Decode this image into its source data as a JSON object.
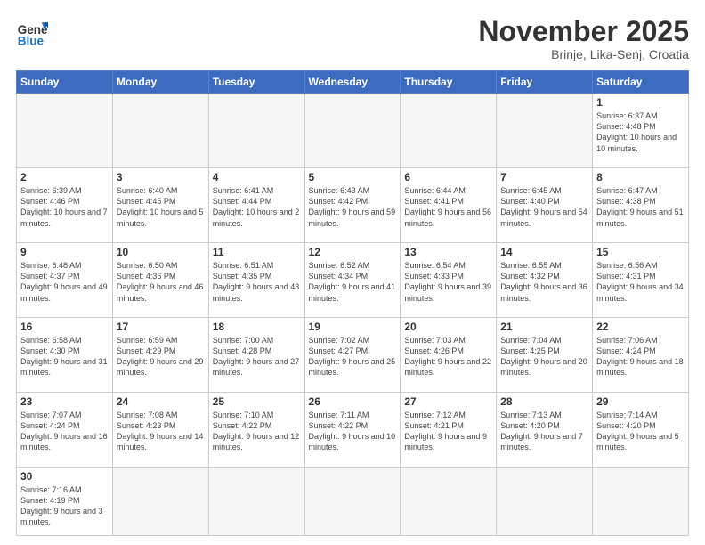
{
  "header": {
    "logo_general": "General",
    "logo_blue": "Blue",
    "title": "November 2025",
    "subtitle": "Brinje, Lika-Senj, Croatia"
  },
  "weekdays": [
    "Sunday",
    "Monday",
    "Tuesday",
    "Wednesday",
    "Thursday",
    "Friday",
    "Saturday"
  ],
  "days": {
    "d1": {
      "num": "1",
      "sunrise": "6:37 AM",
      "sunset": "4:48 PM",
      "daylight": "10 hours and 10 minutes."
    },
    "d2": {
      "num": "2",
      "sunrise": "6:39 AM",
      "sunset": "4:46 PM",
      "daylight": "10 hours and 7 minutes."
    },
    "d3": {
      "num": "3",
      "sunrise": "6:40 AM",
      "sunset": "4:45 PM",
      "daylight": "10 hours and 5 minutes."
    },
    "d4": {
      "num": "4",
      "sunrise": "6:41 AM",
      "sunset": "4:44 PM",
      "daylight": "10 hours and 2 minutes."
    },
    "d5": {
      "num": "5",
      "sunrise": "6:43 AM",
      "sunset": "4:42 PM",
      "daylight": "9 hours and 59 minutes."
    },
    "d6": {
      "num": "6",
      "sunrise": "6:44 AM",
      "sunset": "4:41 PM",
      "daylight": "9 hours and 56 minutes."
    },
    "d7": {
      "num": "7",
      "sunrise": "6:45 AM",
      "sunset": "4:40 PM",
      "daylight": "9 hours and 54 minutes."
    },
    "d8": {
      "num": "8",
      "sunrise": "6:47 AM",
      "sunset": "4:38 PM",
      "daylight": "9 hours and 51 minutes."
    },
    "d9": {
      "num": "9",
      "sunrise": "6:48 AM",
      "sunset": "4:37 PM",
      "daylight": "9 hours and 49 minutes."
    },
    "d10": {
      "num": "10",
      "sunrise": "6:50 AM",
      "sunset": "4:36 PM",
      "daylight": "9 hours and 46 minutes."
    },
    "d11": {
      "num": "11",
      "sunrise": "6:51 AM",
      "sunset": "4:35 PM",
      "daylight": "9 hours and 43 minutes."
    },
    "d12": {
      "num": "12",
      "sunrise": "6:52 AM",
      "sunset": "4:34 PM",
      "daylight": "9 hours and 41 minutes."
    },
    "d13": {
      "num": "13",
      "sunrise": "6:54 AM",
      "sunset": "4:33 PM",
      "daylight": "9 hours and 39 minutes."
    },
    "d14": {
      "num": "14",
      "sunrise": "6:55 AM",
      "sunset": "4:32 PM",
      "daylight": "9 hours and 36 minutes."
    },
    "d15": {
      "num": "15",
      "sunrise": "6:56 AM",
      "sunset": "4:31 PM",
      "daylight": "9 hours and 34 minutes."
    },
    "d16": {
      "num": "16",
      "sunrise": "6:58 AM",
      "sunset": "4:30 PM",
      "daylight": "9 hours and 31 minutes."
    },
    "d17": {
      "num": "17",
      "sunrise": "6:59 AM",
      "sunset": "4:29 PM",
      "daylight": "9 hours and 29 minutes."
    },
    "d18": {
      "num": "18",
      "sunrise": "7:00 AM",
      "sunset": "4:28 PM",
      "daylight": "9 hours and 27 minutes."
    },
    "d19": {
      "num": "19",
      "sunrise": "7:02 AM",
      "sunset": "4:27 PM",
      "daylight": "9 hours and 25 minutes."
    },
    "d20": {
      "num": "20",
      "sunrise": "7:03 AM",
      "sunset": "4:26 PM",
      "daylight": "9 hours and 22 minutes."
    },
    "d21": {
      "num": "21",
      "sunrise": "7:04 AM",
      "sunset": "4:25 PM",
      "daylight": "9 hours and 20 minutes."
    },
    "d22": {
      "num": "22",
      "sunrise": "7:06 AM",
      "sunset": "4:24 PM",
      "daylight": "9 hours and 18 minutes."
    },
    "d23": {
      "num": "23",
      "sunrise": "7:07 AM",
      "sunset": "4:24 PM",
      "daylight": "9 hours and 16 minutes."
    },
    "d24": {
      "num": "24",
      "sunrise": "7:08 AM",
      "sunset": "4:23 PM",
      "daylight": "9 hours and 14 minutes."
    },
    "d25": {
      "num": "25",
      "sunrise": "7:10 AM",
      "sunset": "4:22 PM",
      "daylight": "9 hours and 12 minutes."
    },
    "d26": {
      "num": "26",
      "sunrise": "7:11 AM",
      "sunset": "4:22 PM",
      "daylight": "9 hours and 10 minutes."
    },
    "d27": {
      "num": "27",
      "sunrise": "7:12 AM",
      "sunset": "4:21 PM",
      "daylight": "9 hours and 9 minutes."
    },
    "d28": {
      "num": "28",
      "sunrise": "7:13 AM",
      "sunset": "4:20 PM",
      "daylight": "9 hours and 7 minutes."
    },
    "d29": {
      "num": "29",
      "sunrise": "7:14 AM",
      "sunset": "4:20 PM",
      "daylight": "9 hours and 5 minutes."
    },
    "d30": {
      "num": "30",
      "sunrise": "7:16 AM",
      "sunset": "4:19 PM",
      "daylight": "9 hours and 3 minutes."
    }
  }
}
